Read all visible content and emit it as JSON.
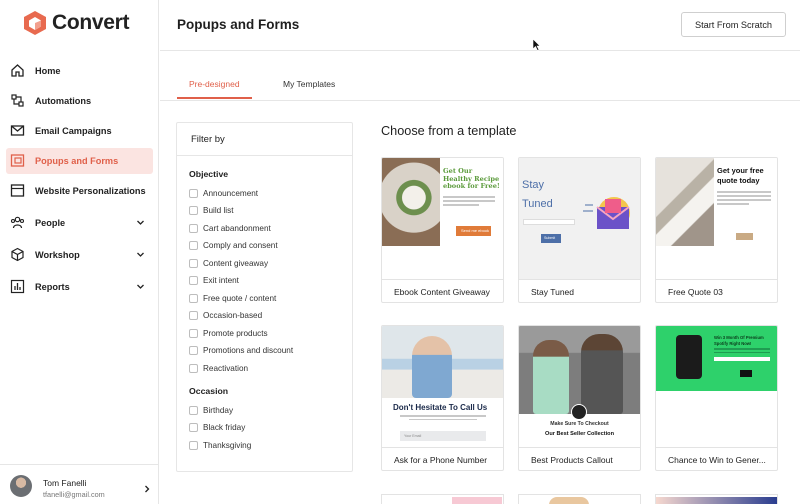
{
  "app": {
    "name": "Convert",
    "brand_color": "#e0604a"
  },
  "sidebar": {
    "items": [
      {
        "label": "Home",
        "icon": "home-icon"
      },
      {
        "label": "Automations",
        "icon": "automations-icon"
      },
      {
        "label": "Email Campaigns",
        "icon": "mail-icon"
      },
      {
        "label": "Popups and Forms",
        "icon": "popup-icon",
        "active": true
      },
      {
        "label": "Website Personalizations",
        "icon": "browser-icon"
      },
      {
        "label": "People",
        "icon": "people-icon",
        "expandable": true
      },
      {
        "label": "Workshop",
        "icon": "box-icon",
        "expandable": true
      },
      {
        "label": "Reports",
        "icon": "chart-icon",
        "expandable": true
      }
    ],
    "user": {
      "name": "Tom Fanelli",
      "email": "tfanelli@gmail.com"
    }
  },
  "header": {
    "title": "Popups and Forms",
    "scratch_button": "Start From Scratch"
  },
  "tabs": [
    {
      "label": "Pre-designed",
      "active": true
    },
    {
      "label": "My Templates",
      "active": false
    }
  ],
  "filter": {
    "title": "Filter by",
    "objective_heading": "Objective",
    "objective": [
      "Announcement",
      "Build list",
      "Cart abandonment",
      "Comply and consent",
      "Content giveaway",
      "Exit intent",
      "Free quote / content",
      "Occasion-based",
      "Promote products",
      "Promotions and discount",
      "Reactivation"
    ],
    "occasion_heading": "Occasion",
    "occasion": [
      "Birthday",
      "Black friday",
      "Thanksgiving"
    ]
  },
  "templates": {
    "heading": "Choose from a template",
    "cards": [
      {
        "name": "Ebook Content Giveaway",
        "thumb_heading": "Get Our Healthy Recipe ebook for Free!",
        "thumb_button": "Send me ebook"
      },
      {
        "name": "Stay Tuned",
        "thumb_heading_1": "Stay",
        "thumb_heading_2": "Tuned",
        "thumb_button": "Submit"
      },
      {
        "name": "Free Quote 03",
        "thumb_heading": "Get your free quote today"
      },
      {
        "name": "Ask for a Phone Number",
        "thumb_heading": "Don't Hesitate To Call Us",
        "thumb_input": "Your Email"
      },
      {
        "name": "Best Products Callout",
        "thumb_line_1": "Make Sure To Checkout",
        "thumb_line_2": "Our Best Seller Collection"
      },
      {
        "name": "Chance to Win to Gener...",
        "thumb_heading": "Win 3 Month Of Premium Spotify Right Now!"
      }
    ]
  }
}
